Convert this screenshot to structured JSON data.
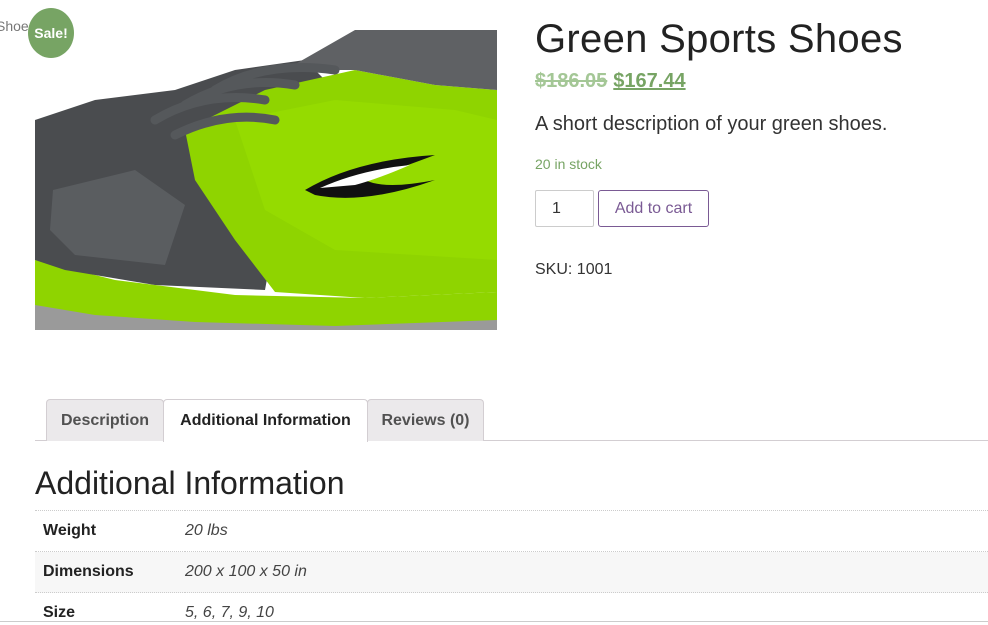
{
  "breadcrumb": {
    "fragment": "Shoe"
  },
  "badge": {
    "label": "Sale!"
  },
  "product": {
    "title": "Green Sports Shoes",
    "price_old": "$186.05",
    "price_new": "$167.44",
    "short_description": "A short description of your green shoes.",
    "stock": "20 in stock",
    "quantity": "1",
    "add_to_cart_label": "Add to cart",
    "sku": "SKU: 1001"
  },
  "tabs": [
    {
      "label": "Description",
      "active": false
    },
    {
      "label": "Additional Information",
      "active": true
    },
    {
      "label": "Reviews (0)",
      "active": false
    }
  ],
  "additional_info": {
    "title": "Additional Information",
    "rows": [
      {
        "label": "Weight",
        "value": "20 lbs"
      },
      {
        "label": "Dimensions",
        "value": "200 x 100 x 50 in"
      },
      {
        "label": "Size",
        "value": "5, 6, 7, 9, 10"
      }
    ]
  },
  "colors": {
    "accent_green": "#77a464",
    "button_purple": "#7a5a94",
    "shoe_green": "#8fd400",
    "shoe_gray": "#4a4c4f"
  }
}
